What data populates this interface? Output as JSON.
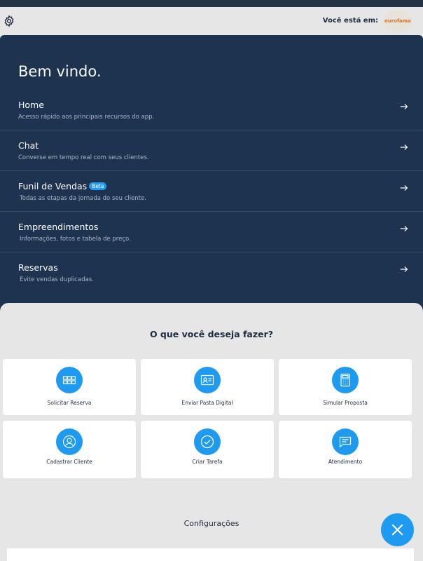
{
  "header": {
    "location_label": "Você está em:",
    "logo_text": "eurofama"
  },
  "welcome": "Bem vindo.",
  "menu": [
    {
      "title": "Home",
      "subtitle": "Acesso rápido aos principais recursos do app."
    },
    {
      "title": "Chat",
      "subtitle": "Converse em tempo real com seus clientes."
    },
    {
      "title": "Funil de Vendas",
      "badge": "Beta",
      "subtitle": "Todas as etapas da jornada do seu cliente."
    },
    {
      "title": "Empreendimentos",
      "subtitle": "Informações, fotos e tabela de preço."
    },
    {
      "title": "Reservas",
      "subtitle": "Evite vendas duplicadas."
    }
  ],
  "sheet": {
    "title": "O que você deseja fazer?",
    "actions": [
      {
        "label": "Solicitar Reserva",
        "icon": "grid-icon"
      },
      {
        "label": "Enviar Pasta Digital",
        "icon": "id-card-icon"
      },
      {
        "label": "Simular Proposta",
        "icon": "calculator-icon"
      },
      {
        "label": "Cadastrar Cliente",
        "icon": "user-icon"
      },
      {
        "label": "Criar Tarefa",
        "icon": "check-icon"
      },
      {
        "label": "Atendimento",
        "icon": "message-icon"
      }
    ],
    "config_label": "Configurações"
  },
  "colors": {
    "panel": "#1d3350",
    "accent": "#1e9bf0",
    "sheet": "#e6e6e6"
  }
}
